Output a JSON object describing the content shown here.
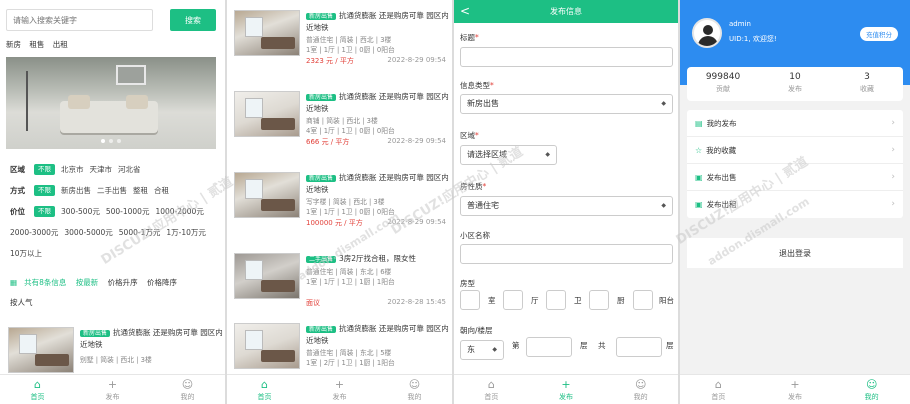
{
  "panel1": {
    "search": {
      "placeholder": "请输入搜索关键字",
      "button": "搜索"
    },
    "quick_links": [
      "新房",
      "租售",
      "出租"
    ],
    "filters": {
      "region": {
        "label": "区域",
        "tag": "不限",
        "options": [
          "北京市",
          "天津市",
          "河北省"
        ]
      },
      "method": {
        "label": "方式",
        "tag": "不限",
        "options": [
          "新房出售",
          "二手出售",
          "整租",
          "合租"
        ]
      },
      "price": {
        "label": "价位",
        "tag": "不限",
        "options": [
          "300-500元",
          "500-1000元",
          "1000-2000元",
          "2000-3000元",
          "3000-5000元",
          "5000-1万元",
          "1万-10万元",
          "10万以上"
        ]
      }
    },
    "sort": {
      "count_prefix": "共有",
      "count": "8条信息",
      "options": [
        "按最新",
        "价格升序",
        "价格降序",
        "按人气"
      ]
    },
    "listing": {
      "badge": "新房出售",
      "title": "抗通货膨胀 还是购房可靠 园区内 近地铁",
      "meta": "别墅 | 简装 | 西北 | 3楼"
    }
  },
  "panel2": {
    "listings": [
      {
        "badge": "新房出售",
        "title": "抗通货膨胀 还是购房可靠 园区内 近地铁",
        "meta1": "普通住宅 | 简装 | 西北 | 3楼",
        "meta2": "1室 | 1厅 | 1卫 | 0厨 | 0阳台",
        "price": "2323 元 / 平方",
        "date": "2022-8-29 09:54"
      },
      {
        "badge": "新房出售",
        "title": "抗通货膨胀 还是购房可靠 园区内 近地铁",
        "meta1": "商铺 | 简装 | 西北 | 3楼",
        "meta2": "4室 | 1厅 | 1卫 | 0厨 | 0阳台",
        "price": "666 元 / 平方",
        "date": "2022-8-29 09:54"
      },
      {
        "badge": "新房出售",
        "title": "抗通货膨胀 还是购房可靠 园区内 近地铁",
        "meta1": "写字楼 | 简装 | 西北 | 3楼",
        "meta2": "1室 | 1厅 | 1卫 | 0厨 | 0阳台",
        "price": "100000 元 / 平方",
        "date": "2022-8-29 09:54"
      },
      {
        "badge": "二手出售",
        "title": "3房2厅找合租，限女性",
        "meta1": "普通住宅 | 简装 | 东北 | 6楼",
        "meta2": "1室 | 1厅 | 1卫 | 1厨 | 1阳台",
        "price": "面议",
        "date": "2022-8-28 15:45"
      },
      {
        "badge": "新房出售",
        "title": "抗通货膨胀 还是购房可靠 园区内 近地铁",
        "meta1": "普通住宅 | 简装 | 东北 | 5楼",
        "meta2": "1室 | 2厅 | 1卫 | 1厨 | 1阳台",
        "price": "",
        "date": ""
      }
    ]
  },
  "panel3": {
    "title": "发布信息",
    "back": "<",
    "labels": {
      "title": "标题",
      "type": "信息类型",
      "region": "区域",
      "property": "房性质",
      "community": "小区名称",
      "layout": "房型",
      "orient_floor": "朝向/楼层"
    },
    "req": "*",
    "values": {
      "type": "新房出售",
      "region": "请选择区域",
      "property": "普通住宅",
      "orient": "东"
    },
    "layout_units": [
      "室",
      "厅",
      "卫",
      "厨",
      "阳台"
    ],
    "floor_units": [
      "第",
      "层",
      "共",
      "层"
    ]
  },
  "panel4": {
    "user": {
      "name": "admin",
      "uid": "UID:1, 欢迎您!"
    },
    "recharge": "充值积分",
    "stats": [
      {
        "n": "999840",
        "l": "贡献"
      },
      {
        "n": "10",
        "l": "发布"
      },
      {
        "n": "3",
        "l": "收藏"
      }
    ],
    "menu": [
      "我的发布",
      "我的收藏",
      "发布出售",
      "发布出租"
    ],
    "logout": "退出登录"
  },
  "tabbar": {
    "home": "首页",
    "publish": "发布",
    "mine": "我的"
  },
  "watermark": {
    "a": "DISCUZ!应用中心 | 贰道",
    "b": "addon.dismall.com"
  },
  "colors": {
    "accent": "#1dbf84",
    "blue": "#2d8cf0",
    "price": "#e2413a"
  }
}
